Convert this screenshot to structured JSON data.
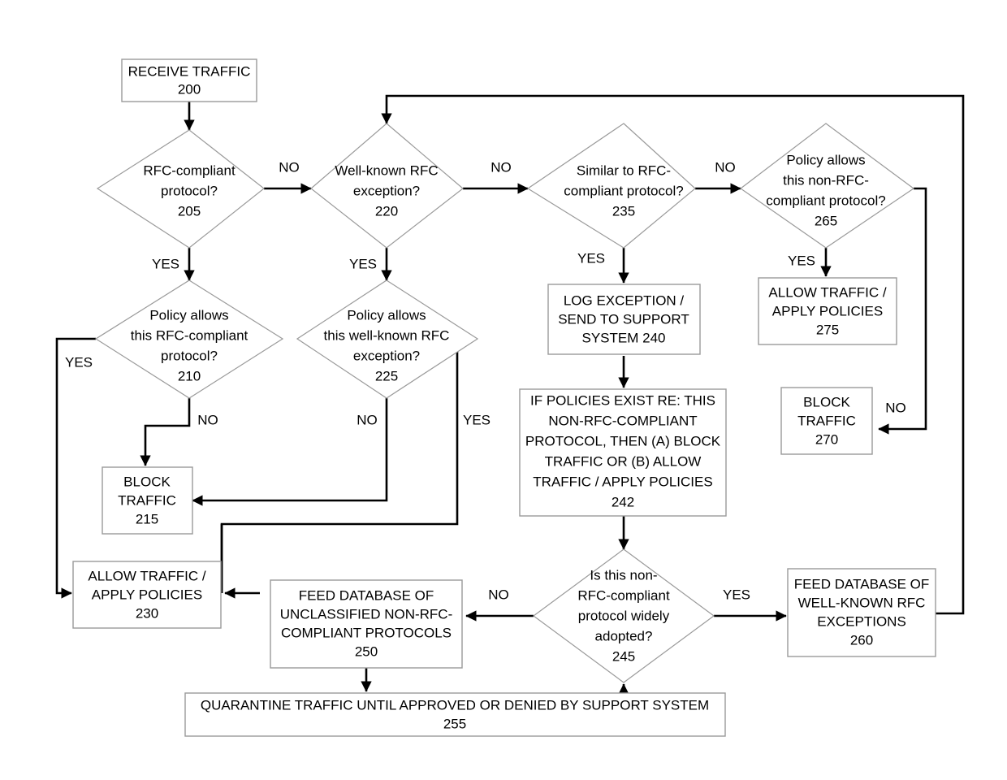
{
  "diagram": {
    "title": "Network traffic RFC-compliance classification flowchart",
    "background_color": "#ffffff",
    "line_color": "#000000",
    "box_stroke_color": "#9a9a9a",
    "nodes": [
      {
        "id": "200",
        "shape": "box",
        "ref": "200",
        "lines": [
          "RECEIVE TRAFFIC",
          "200"
        ],
        "line1": "RECEIVE TRAFFIC",
        "line2": "200",
        "line3": "",
        "line4": "",
        "line5": "",
        "line6": ""
      },
      {
        "id": "205",
        "shape": "diamond",
        "ref": "205",
        "line1": "RFC-compliant",
        "line2": "protocol?",
        "line3": "205",
        "line4": "",
        "line5": "",
        "line6": ""
      },
      {
        "id": "210",
        "shape": "diamond",
        "ref": "210",
        "line1": "Policy allows",
        "line2": "this RFC-compliant",
        "line3": "protocol?",
        "line4": "210",
        "line5": "",
        "line6": ""
      },
      {
        "id": "215",
        "shape": "box",
        "ref": "215",
        "line1": "BLOCK",
        "line2": "TRAFFIC",
        "line3": "215",
        "line4": "",
        "line5": "",
        "line6": ""
      },
      {
        "id": "220",
        "shape": "diamond",
        "ref": "220",
        "line1": "Well-known RFC",
        "line2": "exception?",
        "line3": "220",
        "line4": "",
        "line5": "",
        "line6": ""
      },
      {
        "id": "225",
        "shape": "diamond",
        "ref": "225",
        "line1": "Policy allows",
        "line2": "this well-known RFC",
        "line3": "exception?",
        "line4": "225",
        "line5": "",
        "line6": ""
      },
      {
        "id": "230",
        "shape": "box",
        "ref": "230",
        "line1": "ALLOW TRAFFIC /",
        "line2": "APPLY POLICIES",
        "line3": "230",
        "line4": "",
        "line5": "",
        "line6": ""
      },
      {
        "id": "235",
        "shape": "diamond",
        "ref": "235",
        "line1": "Similar to RFC-",
        "line2": "compliant protocol?",
        "line3": "235",
        "line4": "",
        "line5": "",
        "line6": ""
      },
      {
        "id": "240",
        "shape": "box",
        "ref": "240",
        "line1": "LOG EXCEPTION /",
        "line2": "SEND TO SUPPORT",
        "line3": "SYSTEM 240",
        "line4": "",
        "line5": "",
        "line6": ""
      },
      {
        "id": "242",
        "shape": "box",
        "ref": "242",
        "line1": "IF POLICIES EXIST RE: THIS",
        "line2": "NON-RFC-COMPLIANT",
        "line3": "PROTOCOL, THEN (A) BLOCK",
        "line4": "TRAFFIC OR (B) ALLOW",
        "line5": "TRAFFIC / APPLY POLICIES",
        "line6": "242"
      },
      {
        "id": "245",
        "shape": "diamond",
        "ref": "245",
        "line1": "Is this non-",
        "line2": "RFC-compliant",
        "line3": "protocol widely",
        "line4": "adopted?",
        "line5": "245",
        "line6": ""
      },
      {
        "id": "250",
        "shape": "box",
        "ref": "250",
        "line1": "FEED DATABASE OF",
        "line2": "UNCLASSIFIED NON-RFC-",
        "line3": "COMPLIANT PROTOCOLS",
        "line4": "250",
        "line5": "",
        "line6": ""
      },
      {
        "id": "255",
        "shape": "box",
        "ref": "255",
        "line1": "QUARANTINE TRAFFIC UNTIL APPROVED OR DENIED BY SUPPORT SYSTEM",
        "line2": "255",
        "line3": "",
        "line4": "",
        "line5": "",
        "line6": ""
      },
      {
        "id": "260",
        "shape": "box",
        "ref": "260",
        "line1": "FEED DATABASE OF",
        "line2": "WELL-KNOWN RFC",
        "line3": "EXCEPTIONS",
        "line4": "260",
        "line5": "",
        "line6": ""
      },
      {
        "id": "265",
        "shape": "diamond",
        "ref": "265",
        "line1": "Policy allows",
        "line2": "this non-RFC-",
        "line3": "compliant protocol?",
        "line4": "265",
        "line5": "",
        "line6": ""
      },
      {
        "id": "270",
        "shape": "box",
        "ref": "270",
        "line1": "BLOCK",
        "line2": "TRAFFIC",
        "line3": "270",
        "line4": "",
        "line5": "",
        "line6": ""
      },
      {
        "id": "275",
        "shape": "box",
        "ref": "275",
        "line1": "ALLOW TRAFFIC /",
        "line2": "APPLY POLICIES",
        "line3": "275",
        "line4": "",
        "line5": "",
        "line6": ""
      }
    ],
    "edge_labels": {
      "e205_no": "NO",
      "e205_yes": "YES",
      "e210_yes": "YES",
      "e210_no": "NO",
      "e220_no": "NO",
      "e220_yes": "YES",
      "e225_no": "NO",
      "e225_yes": "YES",
      "e235_no": "NO",
      "e235_yes": "YES",
      "e245_no": "NO",
      "e245_yes": "YES",
      "e265_yes": "YES",
      "e265_no": "NO"
    }
  }
}
